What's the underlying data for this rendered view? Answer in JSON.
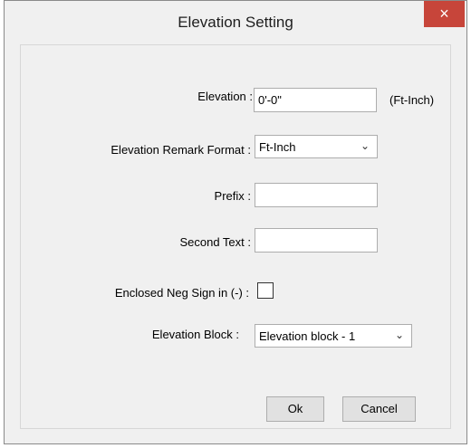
{
  "window": {
    "title": "Elevation Setting",
    "close_icon": "×"
  },
  "form": {
    "elevation_label": "Elevation :",
    "elevation_value": "0'-0\"",
    "elevation_unit": "(Ft-Inch)",
    "remark_format_label": "Elevation Remark Format :",
    "remark_format_value": "Ft-Inch",
    "prefix_label": "Prefix :",
    "prefix_value": "",
    "second_text_label": "Second Text :",
    "second_text_value": "",
    "neg_sign_label": "Enclosed Neg Sign in (-) :",
    "neg_sign_checked": false,
    "block_label": "Elevation Block :",
    "block_value": "Elevation block - 1"
  },
  "buttons": {
    "ok_label": "Ok",
    "cancel_label": "Cancel"
  },
  "icons": {
    "close": "close-icon",
    "dropdown": "chevron-down-icon"
  },
  "colors": {
    "close_button": "#c7453a",
    "window_bg": "#f0f0f0"
  }
}
